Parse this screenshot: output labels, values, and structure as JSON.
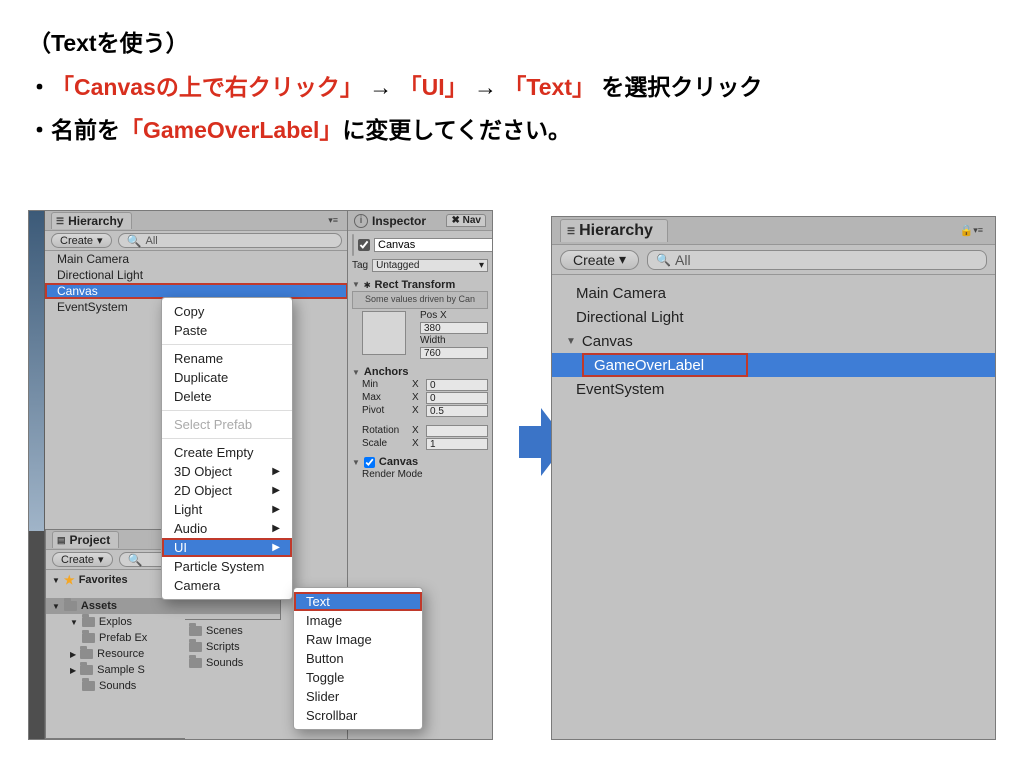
{
  "instructions": {
    "heading": "（Textを使う）",
    "line1_pre": "・ ",
    "line1_red1": "「Canvasの上で右クリック」",
    "line1_arrow1": " → ",
    "line1_red2": "「UI」",
    "line1_arrow2": " → ",
    "line1_red3": "「Text」",
    "line1_post": "を選択クリック",
    "line2a": "・名前を",
    "line2_red": "「GameOverLabel」",
    "line2b": "に変更してください。"
  },
  "left": {
    "hierarchy_tab": "Hierarchy",
    "create_btn": "Create",
    "search_hint": "All",
    "items": [
      "Main Camera",
      "Directional Light",
      "Canvas",
      "EventSystem"
    ],
    "context_menu": [
      "Copy",
      "Paste",
      "-",
      "Rename",
      "Duplicate",
      "Delete",
      "-",
      "Select Prefab",
      "-",
      "Create Empty",
      "3D Object",
      "2D Object",
      "Light",
      "Audio",
      "UI",
      "Particle System",
      "Camera"
    ],
    "ui_submenu": [
      "Text",
      "Image",
      "Raw Image",
      "Button",
      "Toggle",
      "Slider",
      "Scrollbar"
    ],
    "project_tab": "Project",
    "project": {
      "favorites": "Favorites",
      "assets": "Assets",
      "assets_children": [
        "Explos",
        "Prefab Ex",
        "Resource",
        "Sample S",
        "Sounds"
      ],
      "second_col": [
        "Scenes",
        "Scripts",
        "Sounds"
      ]
    },
    "inspector": {
      "tab": "Inspector",
      "nav_tab": "Nav",
      "object_name": "Canvas",
      "tag_label": "Tag",
      "tag_value": "Untagged",
      "rect_transform": "Rect Transform",
      "rect_hint": "Some values driven by Can",
      "pos_x_label": "Pos X",
      "pos_x": "380",
      "width_label": "Width",
      "width": "760",
      "anchors_label": "Anchors",
      "min_label": "Min",
      "min_x": "0",
      "max_label": "Max",
      "max_x": "0",
      "pivot_label": "Pivot",
      "pivot_x": "0.5",
      "rotation_label": "Rotation",
      "rotation_x": "",
      "scale_label": "Scale",
      "scale_x": "1",
      "canvas_section": "Canvas",
      "render_mode": "Render Mode"
    }
  },
  "right": {
    "hierarchy_tab": "Hierarchy",
    "create_btn": "Create",
    "search_hint": "All",
    "items": {
      "main_camera": "Main Camera",
      "dir_light": "Directional Light",
      "canvas": "Canvas",
      "game_over": "GameOverLabel",
      "event_system": "EventSystem"
    }
  }
}
